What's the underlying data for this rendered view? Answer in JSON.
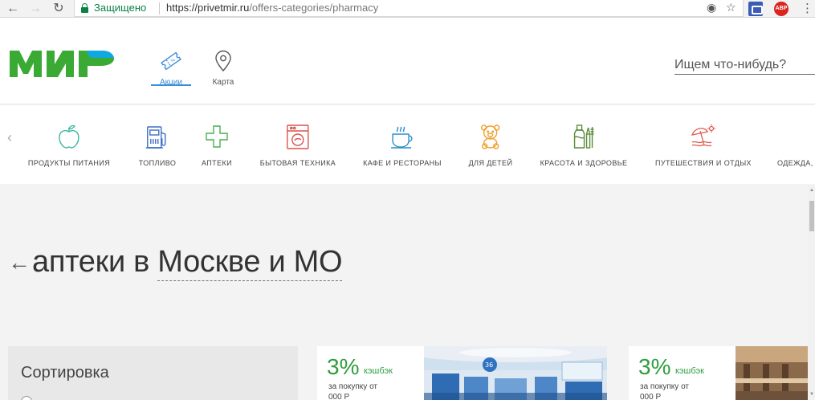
{
  "browser": {
    "secure_label": "Защищено",
    "url_host": "https://privetmir.ru",
    "url_path": "/offers-categories/pharmacy",
    "ext_abp": "ABP"
  },
  "header": {
    "logo_text": "МИР",
    "tabs": [
      {
        "label": "Акции",
        "active": true
      },
      {
        "label": "Карта",
        "active": false
      }
    ],
    "search_placeholder": "Ищем что-нибудь?"
  },
  "categories": [
    {
      "label": "ПРОДУКТЫ ПИТАНИЯ",
      "icon": "apple-icon",
      "color": "#3cb7a0"
    },
    {
      "label": "ТОПЛИВО",
      "icon": "fuel-pump-icon",
      "color": "#3d6fc4"
    },
    {
      "label": "АПТЕКИ",
      "icon": "pharmacy-cross-icon",
      "color": "#4caf50"
    },
    {
      "label": "БЫТОВАЯ ТЕХНИКА",
      "icon": "washing-machine-icon",
      "color": "#d9534f"
    },
    {
      "label": "КАФЕ И РЕСТОРАНЫ",
      "icon": "coffee-cup-icon",
      "color": "#2b8fc9"
    },
    {
      "label": "ДЛЯ ДЕТЕЙ",
      "icon": "teddy-bear-icon",
      "color": "#f0a030"
    },
    {
      "label": "КРАСОТА И ЗДОРОВЬЕ",
      "icon": "cosmetics-icon",
      "color": "#5b8a3a"
    },
    {
      "label": "ПУТЕШЕСТВИЯ И ОТДЫХ",
      "icon": "beach-umbrella-icon",
      "color": "#e25a4f"
    },
    {
      "label": "ОДЕЖДА,",
      "icon": "clothes-icon",
      "color": "#888888"
    }
  ],
  "page": {
    "title_prefix": "аптеки в",
    "region": "Москве и МО"
  },
  "sort": {
    "title": "Сортировка"
  },
  "offers": [
    {
      "cashback": "3%",
      "cashback_word": "кэшбэк",
      "condition_line1": "за покупку от",
      "condition_line2": "000 Р"
    },
    {
      "cashback": "3%",
      "cashback_word": "кэшбэк",
      "condition_line1": "за покупку от",
      "condition_line2": "000 Р"
    }
  ],
  "colors": {
    "brand_green": "#3aaa35",
    "brand_blue": "#0fa8e0",
    "accent_blue": "#3d8ed8",
    "cashback_green": "#2e9e3f"
  }
}
